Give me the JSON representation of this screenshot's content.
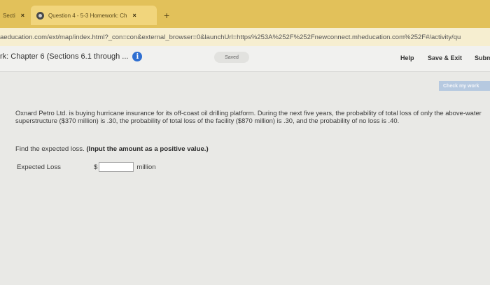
{
  "tabs": [
    {
      "label": "Secti",
      "close": "×"
    },
    {
      "label": "Question 4 - 5-3 Homework: Ch",
      "close": "×"
    }
  ],
  "new_tab": "+",
  "url": "aeducation.com/ext/map/index.html?_con=con&external_browser=0&launchUrl=https%253A%252F%252Fnewconnect.mheducation.com%252F#/activity/qu",
  "header": {
    "title": "rk: Chapter 6 (Sections 6.1 through ...",
    "info_glyph": "i",
    "saved": "Saved",
    "help": "Help",
    "save_exit": "Save & Exit",
    "submit": "Subm",
    "check_work": "Check my work"
  },
  "question": {
    "text": "Oxnard Petro Ltd. is buying hurricane insurance for its off-coast oil drilling platform. During the next five years, the probability of total loss of only the above-water superstructure ($370 million) is .30, the probability of total loss of the facility ($870 million) is .30, and the probability of no loss is .40.",
    "find_text": "Find the expected loss.",
    "find_hint": "(Input the amount as a positive value.)",
    "answer_label": "Expected Loss",
    "currency": "$",
    "answer_value": "",
    "unit": "million"
  }
}
